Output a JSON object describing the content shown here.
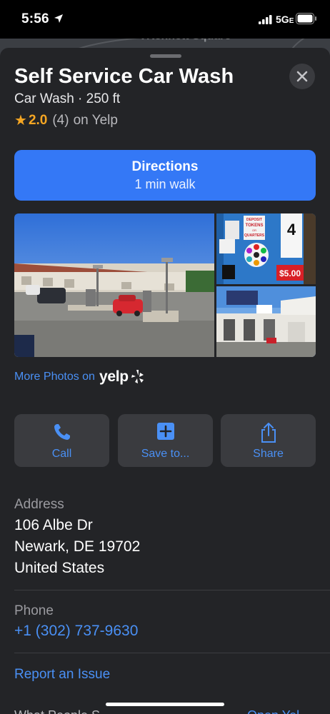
{
  "status_bar": {
    "time": "5:56",
    "network": "5G",
    "network_suffix": "E"
  },
  "map": {
    "label": "Kennett Square"
  },
  "place": {
    "title": "Self Service Car Wash",
    "subtitle": "Car Wash · 250 ft",
    "rating": {
      "star": "★",
      "score": "2.0",
      "count": "(4)",
      "source": "on Yelp"
    }
  },
  "directions": {
    "label": "Directions",
    "sub": "1 min walk"
  },
  "photos": {
    "sign_tokens": "TOKENS",
    "sign_deposit": "DEPOSIT",
    "sign_or": "OR",
    "sign_quarters": "QUARTERS",
    "sign_bay": "4",
    "sign_price": "$5.00"
  },
  "more_photos": {
    "text": "More Photos on",
    "brand": "yelp"
  },
  "actions": [
    {
      "label": "Call",
      "icon": "phone-icon"
    },
    {
      "label": "Save to...",
      "icon": "plus-square-icon"
    },
    {
      "label": "Share",
      "icon": "share-icon"
    }
  ],
  "address": {
    "label": "Address",
    "line1": "106 Albe Dr",
    "line2": "Newark, DE  19702",
    "line3": "United States"
  },
  "phone": {
    "label": "Phone",
    "number": "+1 (302) 737-9630"
  },
  "report": {
    "label": "Report an Issue"
  },
  "footer_cut": {
    "left": "What People S",
    "right": "Open Yel"
  },
  "colors": {
    "accent": "#3478f6",
    "link": "#4a90f5",
    "sheet": "#232427",
    "star": "#f5a623"
  }
}
